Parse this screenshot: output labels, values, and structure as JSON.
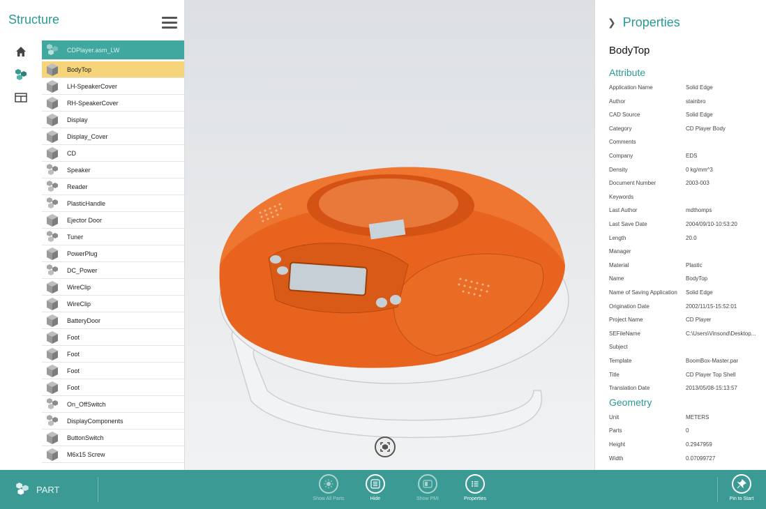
{
  "structure": {
    "title": "Structure",
    "root_label": "CDPlayer.asm_LW",
    "items": [
      {
        "label": "BodyTop",
        "kind": "part",
        "selected": true
      },
      {
        "label": "LH-SpeakerCover",
        "kind": "part"
      },
      {
        "label": "RH-SpeakerCover",
        "kind": "part"
      },
      {
        "label": "Display",
        "kind": "part"
      },
      {
        "label": "Display_Cover",
        "kind": "part"
      },
      {
        "label": "CD",
        "kind": "part"
      },
      {
        "label": "Speaker",
        "kind": "assembly"
      },
      {
        "label": "Reader",
        "kind": "assembly"
      },
      {
        "label": "PlasticHandle",
        "kind": "assembly"
      },
      {
        "label": "Ejector Door",
        "kind": "part"
      },
      {
        "label": "Tuner",
        "kind": "assembly"
      },
      {
        "label": "PowerPlug",
        "kind": "part"
      },
      {
        "label": "DC_Power",
        "kind": "assembly"
      },
      {
        "label": "WireClip",
        "kind": "part"
      },
      {
        "label": "WireClip",
        "kind": "part"
      },
      {
        "label": "BatteryDoor",
        "kind": "part"
      },
      {
        "label": "Foot",
        "kind": "part"
      },
      {
        "label": "Foot",
        "kind": "part"
      },
      {
        "label": "Foot",
        "kind": "part"
      },
      {
        "label": "Foot",
        "kind": "part"
      },
      {
        "label": "On_OffSwitch",
        "kind": "assembly"
      },
      {
        "label": "DisplayComponents",
        "kind": "assembly"
      },
      {
        "label": "ButtonSwitch",
        "kind": "part"
      },
      {
        "label": "M6x15 Screw",
        "kind": "part"
      }
    ]
  },
  "properties": {
    "title": "Properties",
    "part_name": "BodyTop",
    "attribute_title": "Attribute",
    "attributes": [
      {
        "key": "Application Name",
        "value": "Solid Edge"
      },
      {
        "key": "Author",
        "value": "stainbro"
      },
      {
        "key": "CAD Source",
        "value": "Solid Edge"
      },
      {
        "key": "Category",
        "value": "CD Player Body"
      },
      {
        "key": "Comments",
        "value": ""
      },
      {
        "key": "Company",
        "value": "EDS"
      },
      {
        "key": "Density",
        "value": "0 kg/mm^3"
      },
      {
        "key": "Document Number",
        "value": "2003-003"
      },
      {
        "key": "Keywords",
        "value": ""
      },
      {
        "key": "Last Author",
        "value": "mdthomps"
      },
      {
        "key": "Last Save Date",
        "value": "2004/09/10-10:53:20"
      },
      {
        "key": "Length",
        "value": "20.0"
      },
      {
        "key": "Manager",
        "value": ""
      },
      {
        "key": "Material",
        "value": "Plastic"
      },
      {
        "key": "Name",
        "value": "BodyTop"
      },
      {
        "key": "Name of Saving Application",
        "value": "Solid Edge"
      },
      {
        "key": "Origination Date",
        "value": "2002/11/15-15:52:01"
      },
      {
        "key": "Project Name",
        "value": "CD Player"
      },
      {
        "key": "SEFileName",
        "value": "C:\\Users\\Vinsond\\Desktop..."
      },
      {
        "key": "Subject",
        "value": ""
      },
      {
        "key": "Template",
        "value": "BoomBox-Master.par"
      },
      {
        "key": "Title",
        "value": "CD Player Top Shell"
      },
      {
        "key": "Translation Date",
        "value": "2013/05/08-15:13:57"
      }
    ],
    "geometry_title": "Geometry",
    "geometry": [
      {
        "key": "Unit",
        "value": "METERS"
      },
      {
        "key": "Parts",
        "value": "0"
      },
      {
        "key": "Height",
        "value": "0.2947959"
      },
      {
        "key": "Width",
        "value": "0.07099727"
      }
    ]
  },
  "bottombar": {
    "mode_label": "PART",
    "buttons": [
      {
        "label": "Show All Parts",
        "icon": "sun-icon",
        "enabled": false
      },
      {
        "label": "Hide",
        "icon": "list-icon",
        "enabled": true
      },
      {
        "label": "Show PMI",
        "icon": "pmi-icon",
        "enabled": false
      },
      {
        "label": "Properties",
        "icon": "properties-icon",
        "enabled": true
      }
    ],
    "pin_label": "Pin to Start"
  },
  "colors": {
    "accent": "#2a9a92",
    "bar": "#3c9a94",
    "selected_row": "#f6d57a",
    "model_orange": "#e8641e"
  }
}
